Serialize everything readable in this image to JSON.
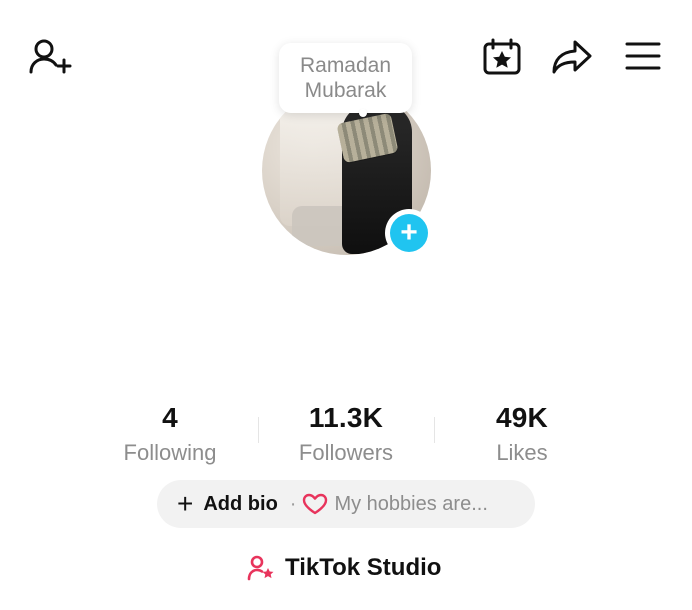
{
  "top_bar": {
    "icons": [
      "add-user-icon",
      "calendar-star-icon",
      "share-icon",
      "menu-icon"
    ]
  },
  "profile": {
    "bubble_line1": "Ramadan",
    "bubble_line2": "Mubarak",
    "add_badge_symbol": "+"
  },
  "stats": {
    "following": {
      "value": "4",
      "label": "Following"
    },
    "followers": {
      "value": "11.3K",
      "label": "Followers"
    },
    "likes": {
      "value": "49K",
      "label": "Likes"
    }
  },
  "bio": {
    "add_label": "Add bio",
    "separator": "·",
    "hobby_placeholder": "My hobbies are..."
  },
  "studio": {
    "label": "TikTok Studio",
    "icon_color": "#e8345c"
  },
  "colors": {
    "accent_blue": "#20c4f0",
    "heart_red": "#e8345c"
  }
}
